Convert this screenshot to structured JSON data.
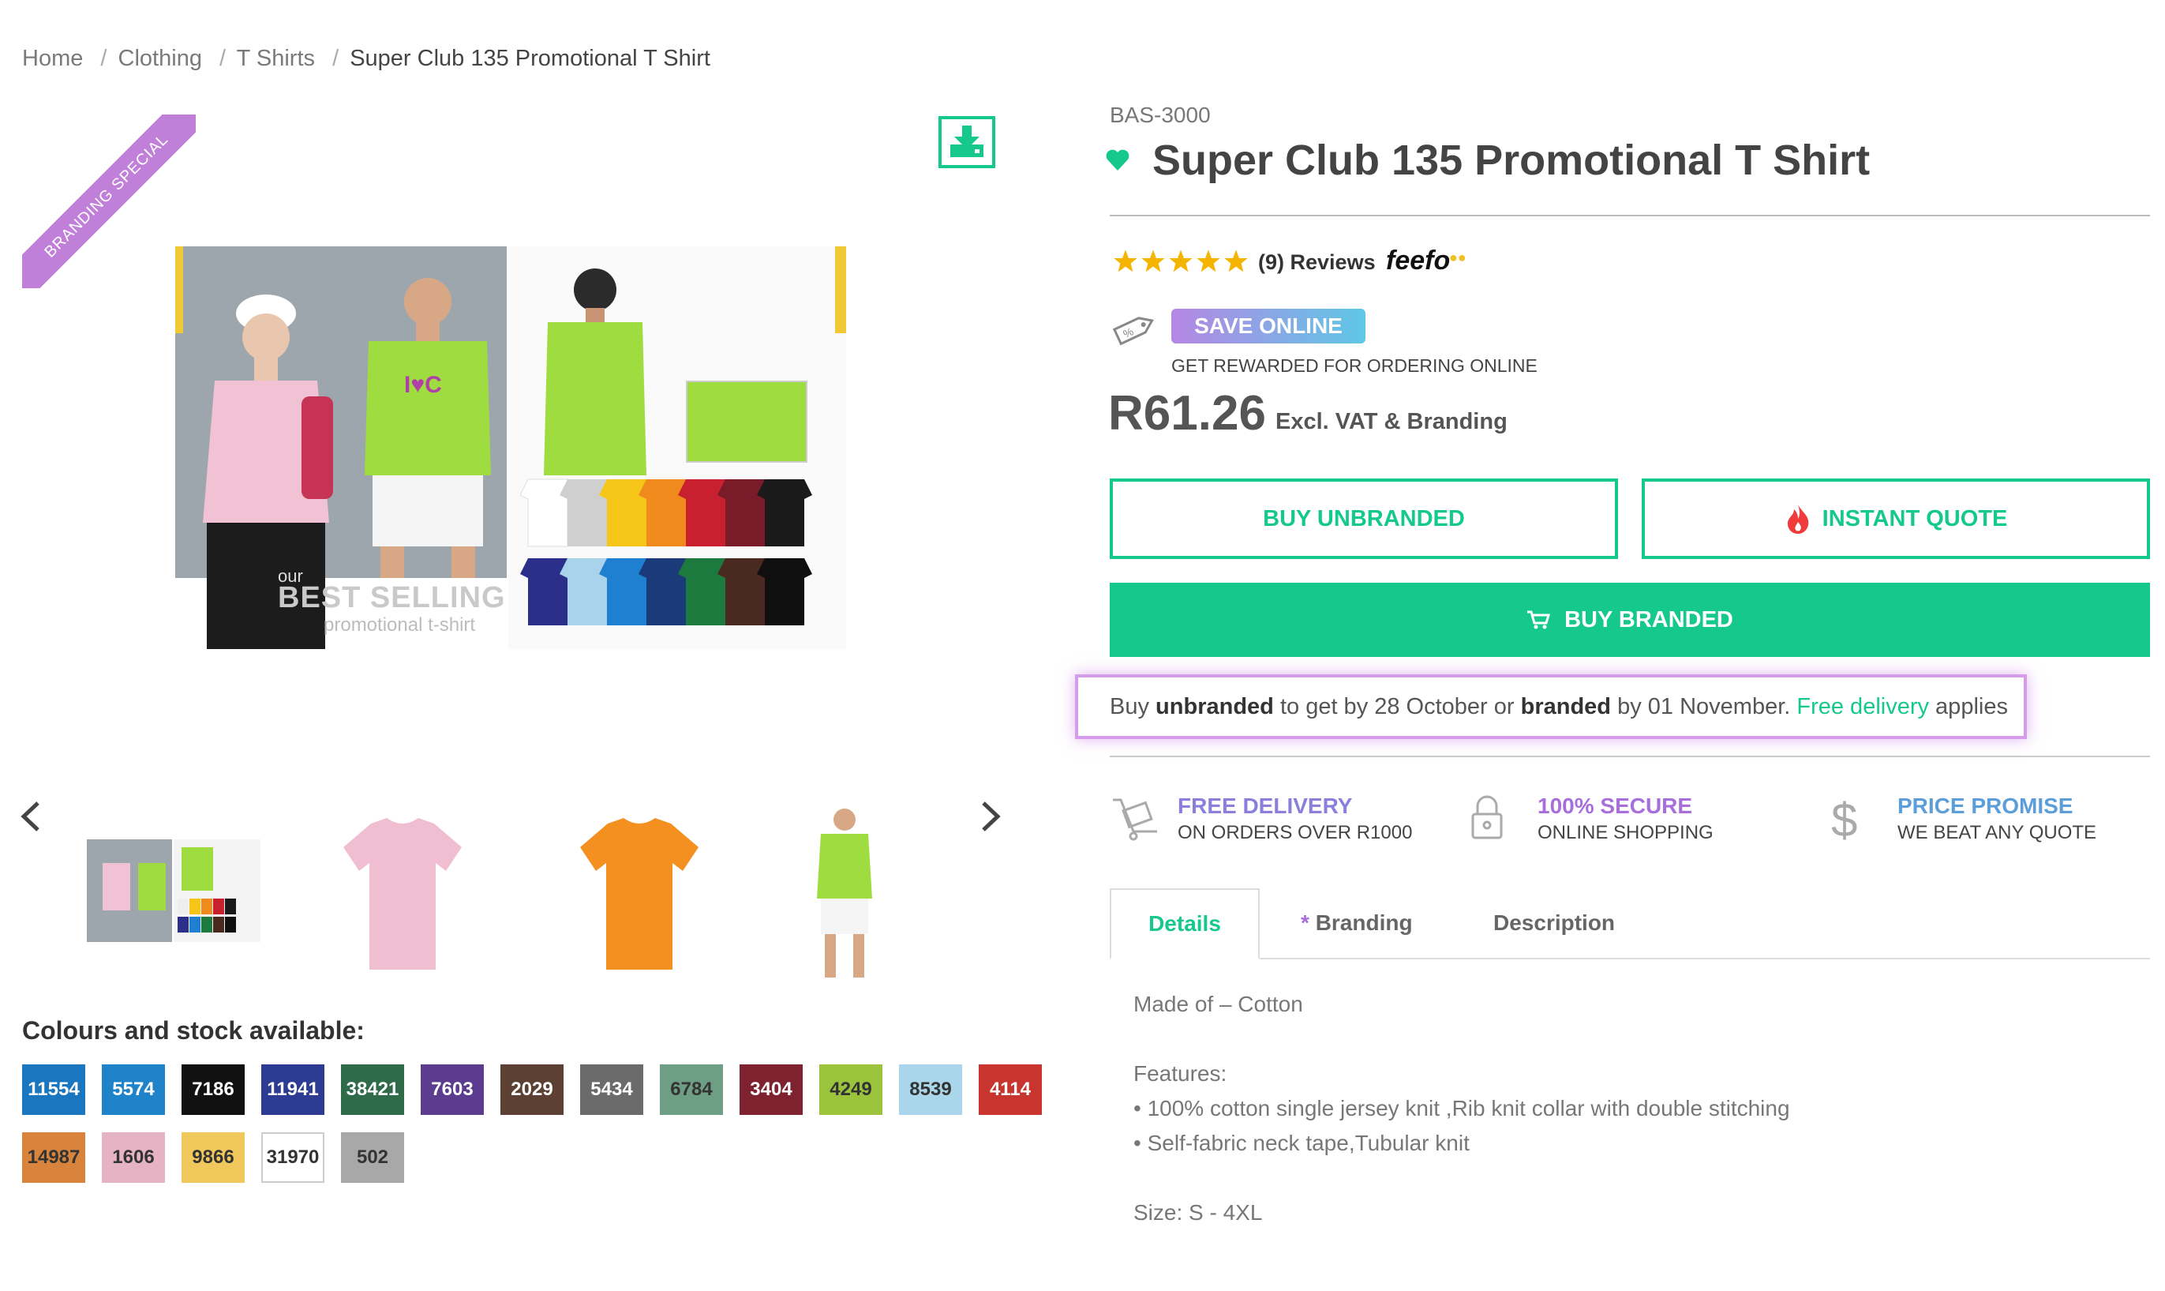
{
  "breadcrumb": {
    "items": [
      "Home",
      "Clothing",
      "T Shirts",
      "Super Club 135 Promotional T Shirt"
    ],
    "separator": "/"
  },
  "gallery": {
    "ribbon": "BRANDING SPECIAL",
    "main_image_text": {
      "our": "our",
      "best_selling": "BEST SELLING",
      "subtitle": "promotional t-shirt"
    },
    "prev_icon": "chevron-left-icon",
    "next_icon": "chevron-right-icon",
    "download_icon": "download-icon"
  },
  "colours": {
    "title": "Colours and stock available:",
    "swatches": [
      {
        "code": "11554",
        "color": "#1a77bf",
        "text": "#ffffff"
      },
      {
        "code": "5574",
        "color": "#1f83c9",
        "text": "#ffffff"
      },
      {
        "code": "7186",
        "color": "#111111",
        "text": "#ffffff"
      },
      {
        "code": "11941",
        "color": "#2d3b92",
        "text": "#ffffff"
      },
      {
        "code": "38421",
        "color": "#2f6b48",
        "text": "#ffffff"
      },
      {
        "code": "7603",
        "color": "#5c3c8e",
        "text": "#ffffff"
      },
      {
        "code": "2029",
        "color": "#5c4033",
        "text": "#ffffff"
      },
      {
        "code": "5434",
        "color": "#6b6b6b",
        "text": "#ffffff"
      },
      {
        "code": "6784",
        "color": "#6e9e83",
        "text": "#333333"
      },
      {
        "code": "3404",
        "color": "#7e2230",
        "text": "#ffffff"
      },
      {
        "code": "4249",
        "color": "#9bc43c",
        "text": "#333333"
      },
      {
        "code": "8539",
        "color": "#a9d6ea",
        "text": "#333333"
      },
      {
        "code": "4114",
        "color": "#c8352f",
        "text": "#ffffff"
      },
      {
        "code": "14987",
        "color": "#d9843d",
        "text": "#333333"
      },
      {
        "code": "1606",
        "color": "#e5b3c4",
        "text": "#333333"
      },
      {
        "code": "9866",
        "color": "#f0c85c",
        "text": "#333333"
      },
      {
        "code": "31970",
        "color": "#ffffff",
        "text": "#333333"
      },
      {
        "code": "502",
        "color": "#a8a8a8",
        "text": "#333333"
      }
    ]
  },
  "product": {
    "sku": "BAS-3000",
    "title": "Super Club 135 Promotional T Shirt",
    "review_count": "(9)",
    "reviews_label": "Reviews",
    "rating": 5,
    "feefo": "feefo",
    "save_badge": "SAVE ONLINE",
    "rewarded": "GET REWARDED FOR ORDERING ONLINE",
    "price": "R61.26",
    "price_note": "Excl. VAT & Branding",
    "buttons": {
      "buy_unbranded": "BUY UNBRANDED",
      "instant_quote": "INSTANT QUOTE",
      "buy_branded": "BUY BRANDED"
    },
    "delivery": {
      "p1": "Buy ",
      "unbranded": "unbranded",
      "p2": " to get by 28 October or ",
      "branded": "branded",
      "p3": " by 01 November. ",
      "free_delivery": "Free delivery",
      "p4": " applies"
    },
    "features": [
      {
        "title": "FREE DELIVERY",
        "sub": "ON ORDERS OVER R1000",
        "icon": "trolley-icon"
      },
      {
        "title": "100% SECURE",
        "sub": "ONLINE SHOPPING",
        "icon": "lock-icon"
      },
      {
        "title": "PRICE PROMISE",
        "sub": "WE BEAT ANY QUOTE",
        "icon": "dollar-icon"
      }
    ],
    "tabs": {
      "details": "Details",
      "branding_star": "*",
      "branding": "Branding",
      "description": "Description"
    },
    "details": {
      "made_of": "Made of – Cotton",
      "features_label": "Features:",
      "feature1": "• 100% cotton single jersey knit ,Rib knit collar with double stitching",
      "feature2": "• Self-fabric neck tape,Tubular knit",
      "size": "Size: S - 4XL"
    }
  },
  "accent": "#15c98d"
}
